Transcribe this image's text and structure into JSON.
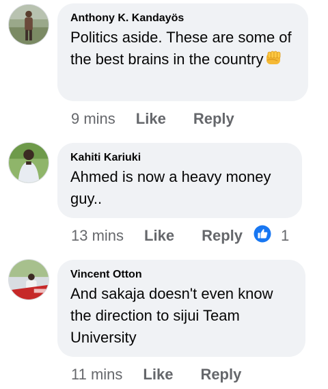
{
  "comments": [
    {
      "author": "Anthony K. Kandayös",
      "text": "Politics aside. These are some of the best brains in the country",
      "emoji": "oncoming-fist-icon",
      "time": "9 mins",
      "like_label": "Like",
      "reply_label": "Reply"
    },
    {
      "author": "Kahiti Kariuki",
      "text": "Ahmed is now a heavy money guy..",
      "time": "13 mins",
      "like_label": "Like",
      "reply_label": "Reply",
      "reaction": {
        "icon": "thumbs-up-icon",
        "count": "1",
        "color": "#1877f2"
      }
    },
    {
      "author": "Vincent Otton",
      "text": "And sakaja doesn't even know the direction to sijui Team University",
      "time": "11 mins",
      "like_label": "Like",
      "reply_label": "Reply"
    }
  ],
  "colors": {
    "bubble": "#f0f2f5",
    "meta_text": "#65676b",
    "body_text": "#050505",
    "like_blue": "#1877f2"
  }
}
